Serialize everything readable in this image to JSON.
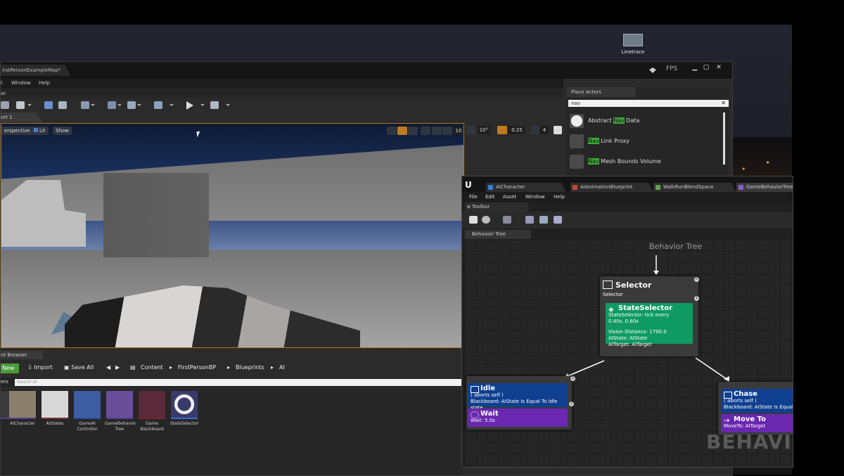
{
  "desktop": {
    "icon_label": "Linetrace"
  },
  "main_window": {
    "map_tab": "irstPersonExampleMap*",
    "fps_label": "FPS",
    "menu": [
      "t",
      "Window",
      "Help"
    ],
    "toolbar_tab": "ar",
    "viewport_tab": "ort 1",
    "viewport_buttons": {
      "perspective": "erspective",
      "lit": "Lit",
      "show": "Show"
    },
    "viewport_values": {
      "grid": "10",
      "rotation": "10°",
      "scale": "0.25",
      "camera_speed": "4"
    }
  },
  "content_browser": {
    "tab": "nt Browser",
    "new_label": "New",
    "import_label": "Import",
    "save_all_label": "Save All",
    "breadcrumb": [
      "Content",
      "FirstPersonBP",
      "Blueprints",
      "AI"
    ],
    "filters_label": "ers",
    "search_placeholder": "Search AI",
    "assets": [
      {
        "label": "n"
      },
      {
        "label": "AICharacter"
      },
      {
        "label": "AIStates"
      },
      {
        "label": "GameAI Controller"
      },
      {
        "label": "GameBehavior Tree"
      },
      {
        "label": "Game Blackboard"
      },
      {
        "label": "StateSelector"
      }
    ]
  },
  "place_actors": {
    "tab": "Place Actors",
    "search_value": "nav",
    "items": [
      {
        "pre": "Abstract ",
        "hl": "Nav",
        "post": " Data"
      },
      {
        "pre": "",
        "hl": "Nav",
        "post": " Link Proxy"
      },
      {
        "pre": "",
        "hl": "Nav",
        "post": " Mesh Bounds Volume"
      }
    ]
  },
  "bt_editor": {
    "tabs": [
      "AICharacter",
      "AIAnimationBlueprint",
      "WalkRunBlendSpace",
      "GameBehaviorTree"
    ],
    "menu": [
      "File",
      "Edit",
      "Asset",
      "Window",
      "Help"
    ],
    "toolbar_tab": "Toolbar",
    "graph_tab": "Behavior Tree",
    "root_label": "Behavior Tree",
    "selector": {
      "title": "Selector",
      "subtitle": "Selector",
      "pin_top": "0",
      "pin_right": "1",
      "service_title": "StateSelector",
      "service_lines": [
        "StateSelector: tick every 0.40s..0.60s",
        "",
        "Vision Distance: 1700.0",
        "AIState: AIState",
        "AITarget: AITarget"
      ]
    },
    "idle": {
      "title": "Idle",
      "pin": "2",
      "pin_right": "3",
      "lines": [
        "( aborts self )",
        "Blackboard: AIState Is Equal To idle state"
      ],
      "task_title": "Wait",
      "task_line": "Wait: 5.0s"
    },
    "chase": {
      "title": "Chase",
      "lines": [
        "( aborts self )",
        "Blackboard: AIState Is Equal"
      ],
      "task_title": "Move To",
      "task_line": "MoveTo: AITarget"
    },
    "watermark": "BEHAVI"
  },
  "colors": {
    "service_green": "#0f9a63",
    "decorator_blue": "#0f3f8f",
    "task_purple": "#6a28b0",
    "highlight_green": "#3fa83a"
  }
}
